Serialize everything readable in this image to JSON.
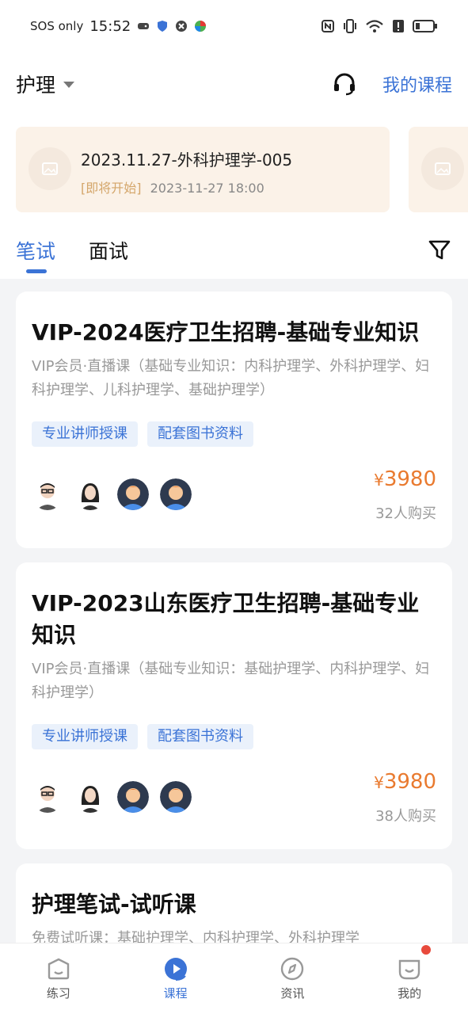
{
  "status_bar": {
    "carrier": "SOS only",
    "time": "15:52"
  },
  "header": {
    "category": "护理",
    "my_courses": "我的课程"
  },
  "banner": {
    "title": "2023.11.27-外科护理学-005",
    "status": "[即将开始]",
    "date": "2023-11-27 18:00"
  },
  "tabs": {
    "written": "笔试",
    "interview": "面试"
  },
  "courses": [
    {
      "title": "VIP-2024医疗卫生招聘-基础专业知识",
      "desc": "VIP会员·直播课（基础专业知识：内科护理学、外科护理学、妇科护理学、儿科护理学、基础护理学）",
      "tags": [
        "专业讲师授课",
        "配套图书资料"
      ],
      "price": "3980",
      "currency": "¥",
      "buyers": "32人购买"
    },
    {
      "title": "VIP-2023山东医疗卫生招聘-基础专业知识",
      "desc": "VIP会员·直播课（基础专业知识：基础护理学、内科护理学、妇科护理学）",
      "tags": [
        "专业讲师授课",
        "配套图书资料"
      ],
      "price": "3980",
      "currency": "¥",
      "buyers": "38人购买"
    },
    {
      "title": "护理笔试-试听课",
      "desc": "免费试听课：基础护理学、内科护理学、外科护理学"
    }
  ],
  "bottom_nav": [
    {
      "label": "练习",
      "icon": "practice-icon"
    },
    {
      "label": "课程",
      "icon": "course-play-icon"
    },
    {
      "label": "资讯",
      "icon": "compass-icon"
    },
    {
      "label": "我的",
      "icon": "profile-icon"
    }
  ],
  "colors": {
    "accent": "#3b73d6",
    "price": "#e97a2f",
    "banner_bg": "#fbf2e8",
    "badge": "#e84a3c"
  }
}
